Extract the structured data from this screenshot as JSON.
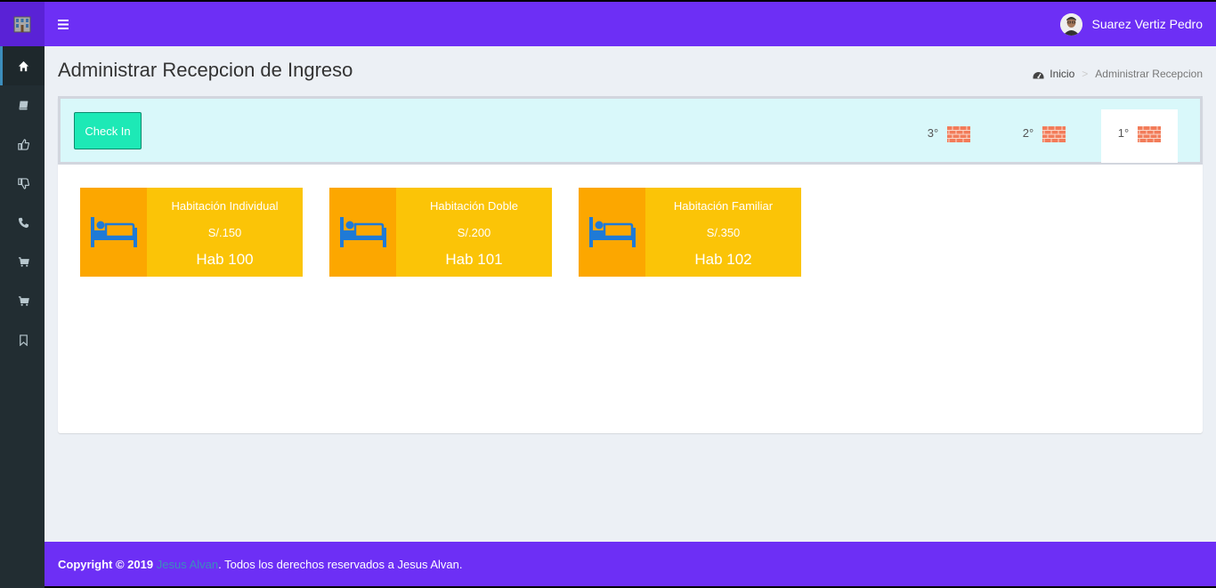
{
  "header": {
    "user_name": "Suarez Vertiz Pedro"
  },
  "sidebar": {
    "items": [
      {
        "icon": "home-icon",
        "active": true
      },
      {
        "icon": "book-icon",
        "active": false
      },
      {
        "icon": "thumbs-up-icon",
        "active": false
      },
      {
        "icon": "thumbs-down-icon",
        "active": false
      },
      {
        "icon": "phone-icon",
        "active": false
      },
      {
        "icon": "cart-icon",
        "active": false
      },
      {
        "icon": "cart-icon",
        "active": false
      },
      {
        "icon": "bookmark-icon",
        "active": false
      }
    ]
  },
  "page": {
    "title": "Administrar Recepcion de Ingreso"
  },
  "breadcrumb": {
    "home": "Inicio",
    "separator": ">",
    "current": "Administrar Recepcion"
  },
  "actions": {
    "checkin_label": "Check In"
  },
  "floors": [
    {
      "label": "3°",
      "active": false
    },
    {
      "label": "2°",
      "active": false
    },
    {
      "label": "1°",
      "active": true
    }
  ],
  "rooms": [
    {
      "type": "Habitación Individual",
      "price": "S/.150",
      "number": "Hab 100"
    },
    {
      "type": "Habitación Doble",
      "price": "S/.200",
      "number": "Hab 101"
    },
    {
      "type": "Habitación Familiar",
      "price": "S/.350",
      "number": "Hab 102"
    }
  ],
  "footer": {
    "copyright": "Copyright © 2019",
    "author_link": "Jesus Alvan",
    "rights": ". Todos los derechos reservados a Jesus Alvan."
  },
  "colors": {
    "topbar": "#6d2ff5",
    "sidebar": "#222d32",
    "room_card": "#fbc407",
    "room_icon_bg": "#fca700",
    "bed_icon": "#1f7ad6",
    "brick_icon": "#f27c5a",
    "checkin_button": "#1de9b6",
    "box_header": "#d9f8fa"
  }
}
